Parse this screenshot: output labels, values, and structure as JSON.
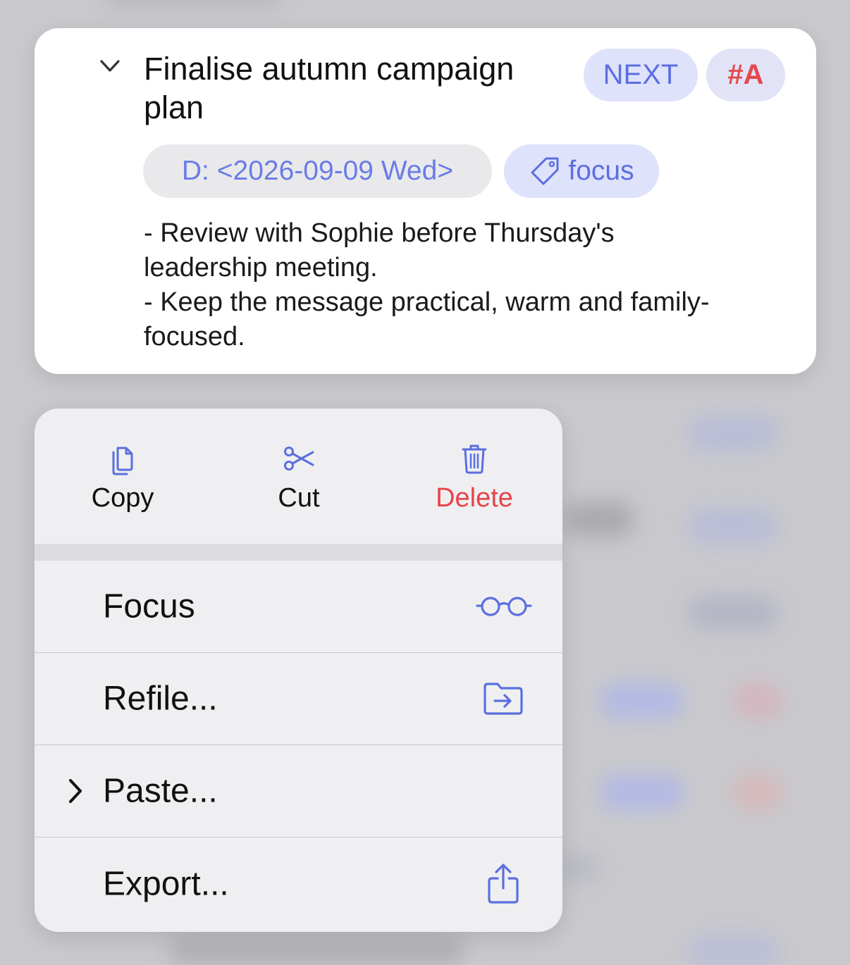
{
  "task": {
    "title": "Finalise autumn campaign plan",
    "state": "NEXT",
    "priority": "#A",
    "deadline": "D: <2026-09-09 Wed>",
    "tag": "focus",
    "notes": [
      "- Review with Sophie before Thursday's",
      "leadership meeting.",
      "- Keep the message practical, warm and family-",
      "focused."
    ]
  },
  "context_menu": {
    "actions": [
      {
        "label": "Copy",
        "icon": "copy-icon"
      },
      {
        "label": "Cut",
        "icon": "scissors-icon"
      },
      {
        "label": "Delete",
        "icon": "trash-icon"
      }
    ],
    "items": [
      {
        "label": "Focus",
        "icon": "glasses-icon"
      },
      {
        "label": "Refile...",
        "icon": "folder-arrow-icon"
      },
      {
        "label": "Paste...",
        "icon": "chevron-right-icon"
      },
      {
        "label": "Export...",
        "icon": "share-icon"
      }
    ]
  },
  "colors": {
    "accent": "#5b6fe0",
    "danger": "#e8444a",
    "next_pill_bg": "#dfe2fb",
    "deadline_pill_bg": "#e9e9ec"
  }
}
